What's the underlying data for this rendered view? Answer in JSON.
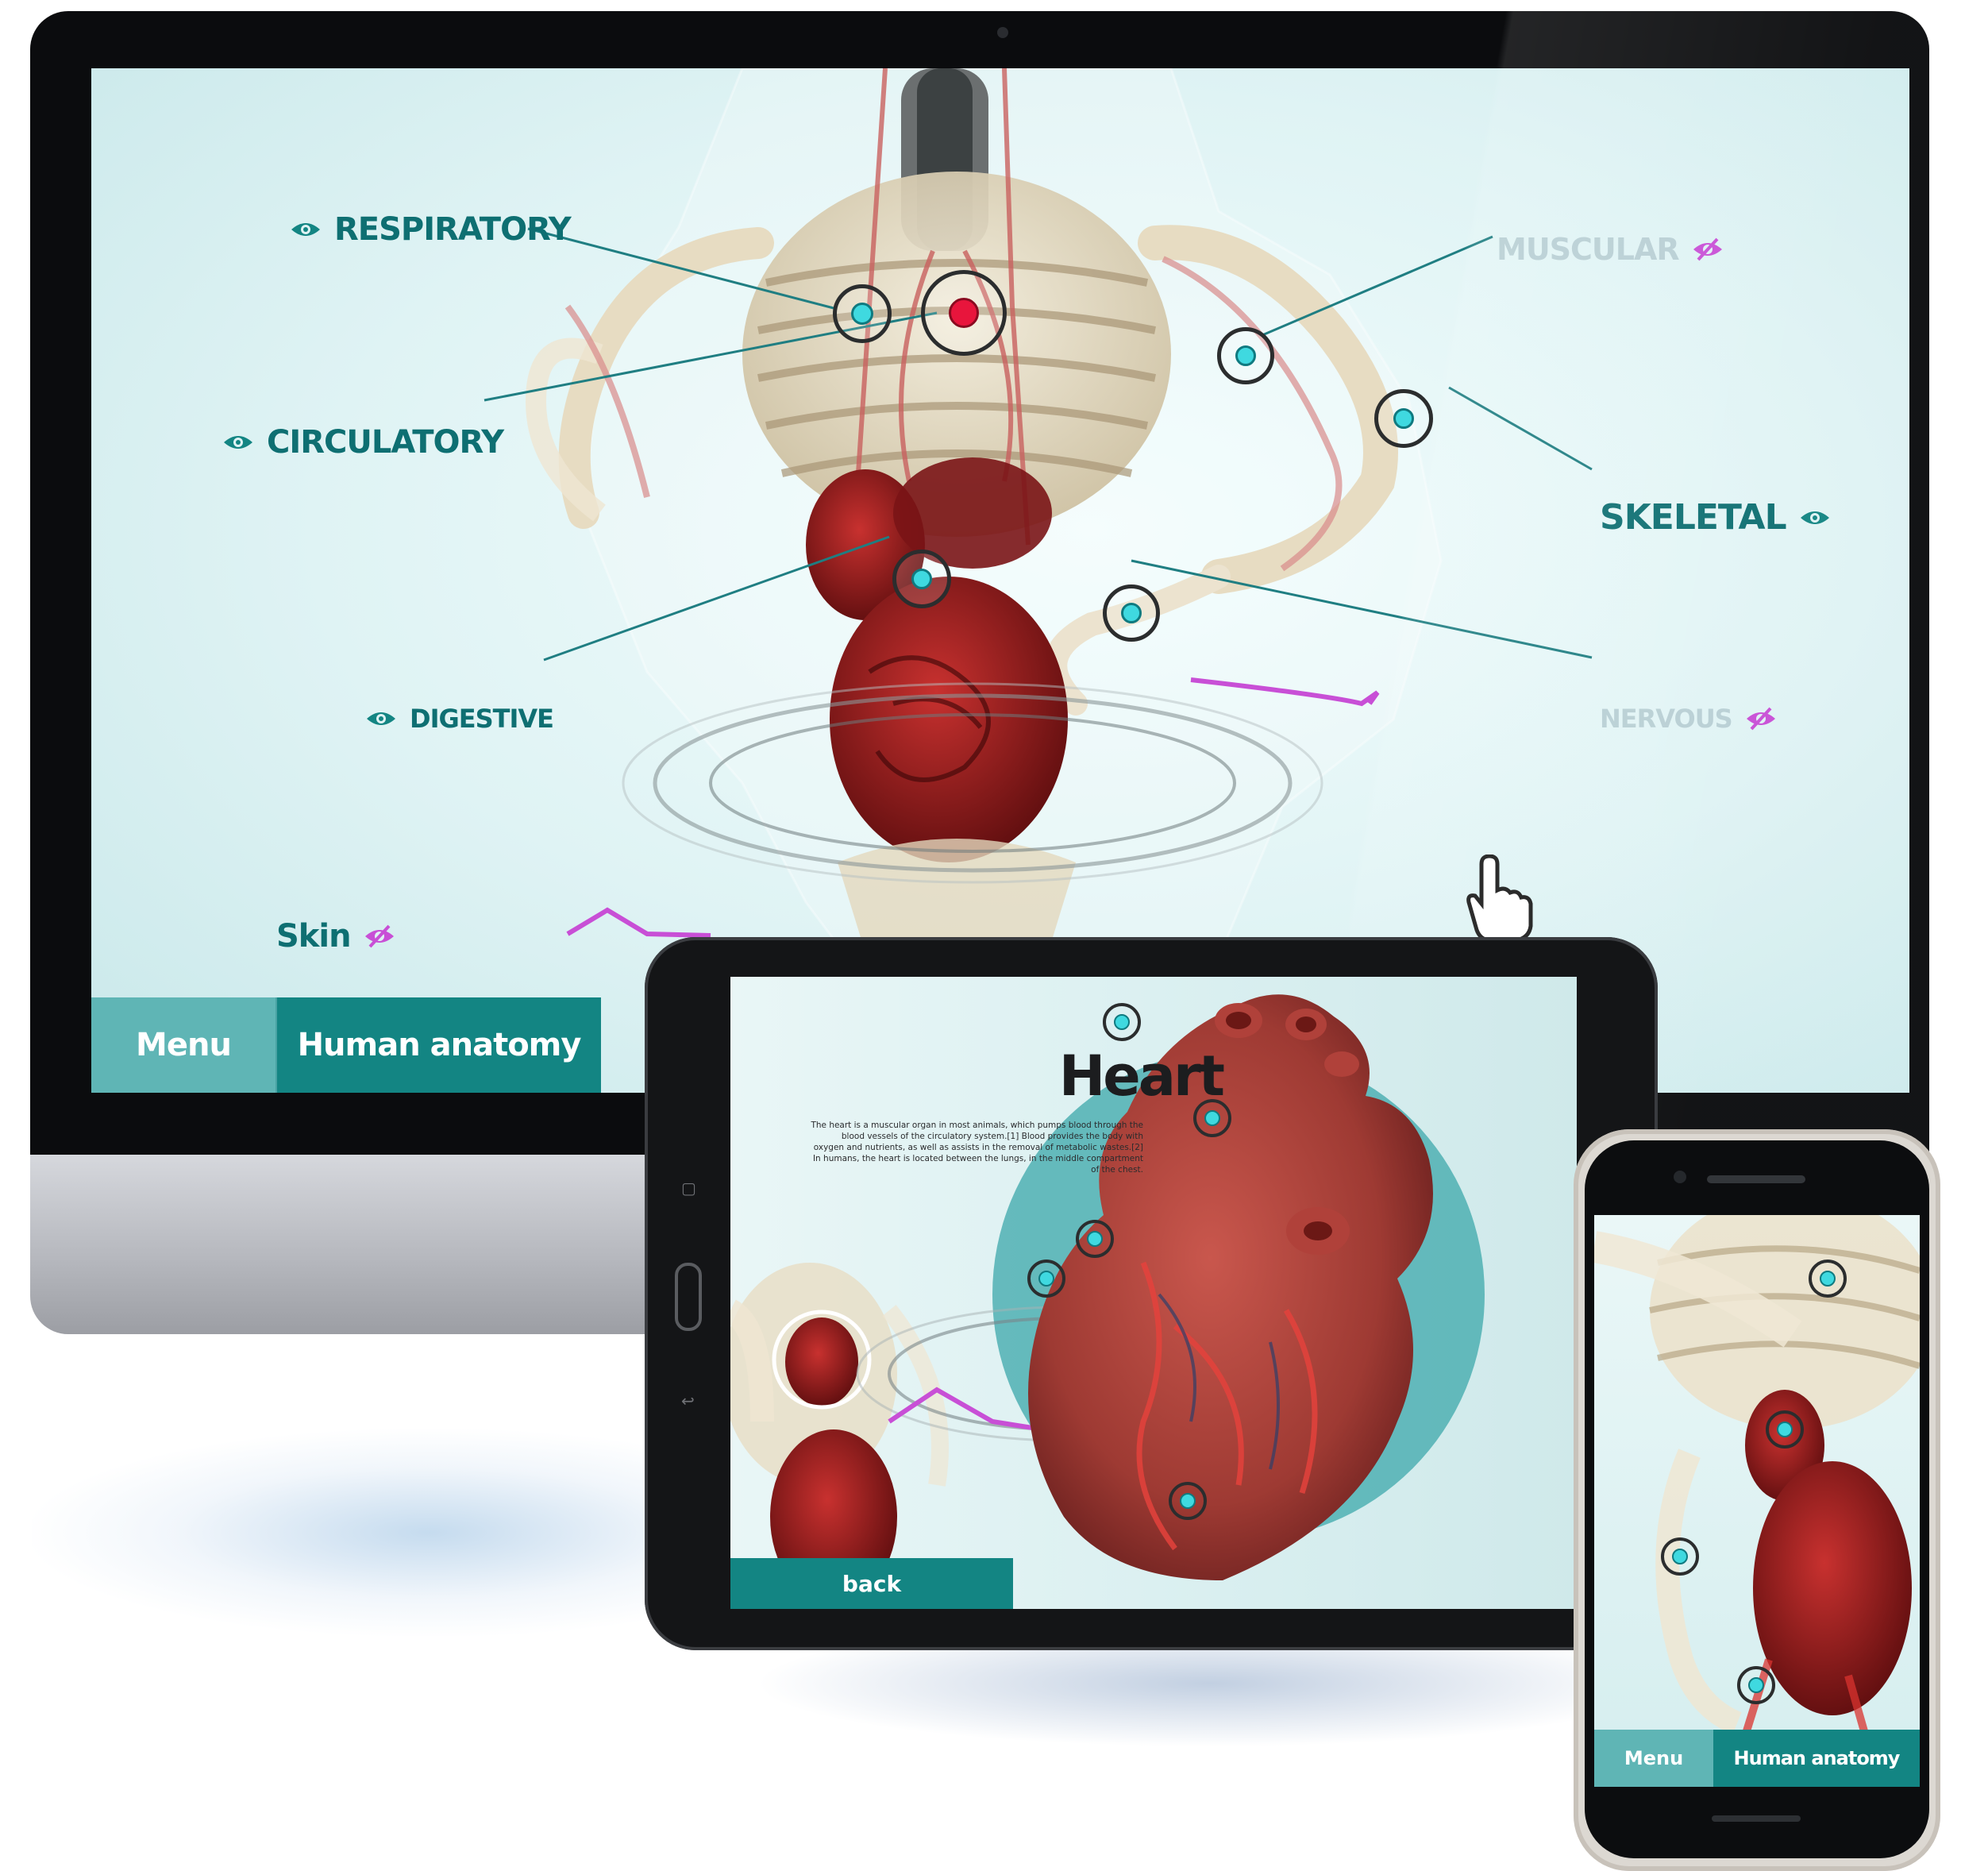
{
  "desktop": {
    "labels": {
      "respiratory": "RESPIRATORY",
      "circulatory": "CIRCULATORY",
      "digestive": "DIGESTIVE",
      "muscular": "MUSCULAR",
      "skeletal": "SKELETAL",
      "nervous": "NERVOUS",
      "skin": "Skin"
    },
    "menu_label": "Menu",
    "title_label": "Human anatomy"
  },
  "tablet": {
    "heading": "Heart",
    "description": "The heart is a muscular organ in most animals, which pumps blood through the blood vessels of the circulatory system.[1] Blood provides the body with oxygen and nutrients, as well as assists in the removal of metabolic wastes.[2] In humans, the heart is located between the lungs, in the middle compartment of the chest.",
    "back_label": "back"
  },
  "phone": {
    "menu_label": "Menu",
    "title_label": "Human anatomy"
  },
  "colors": {
    "accent_teal": "#138583",
    "light_teal": "#5fb5b5",
    "hotspot_active": "#e8153c",
    "hotspot_cyan": "#3fd9e0",
    "hidden_eye": "#c84fd6"
  },
  "icons": {
    "visible": "eye-icon",
    "hidden": "eye-off-icon",
    "cursor": "hand-pointer-icon"
  }
}
